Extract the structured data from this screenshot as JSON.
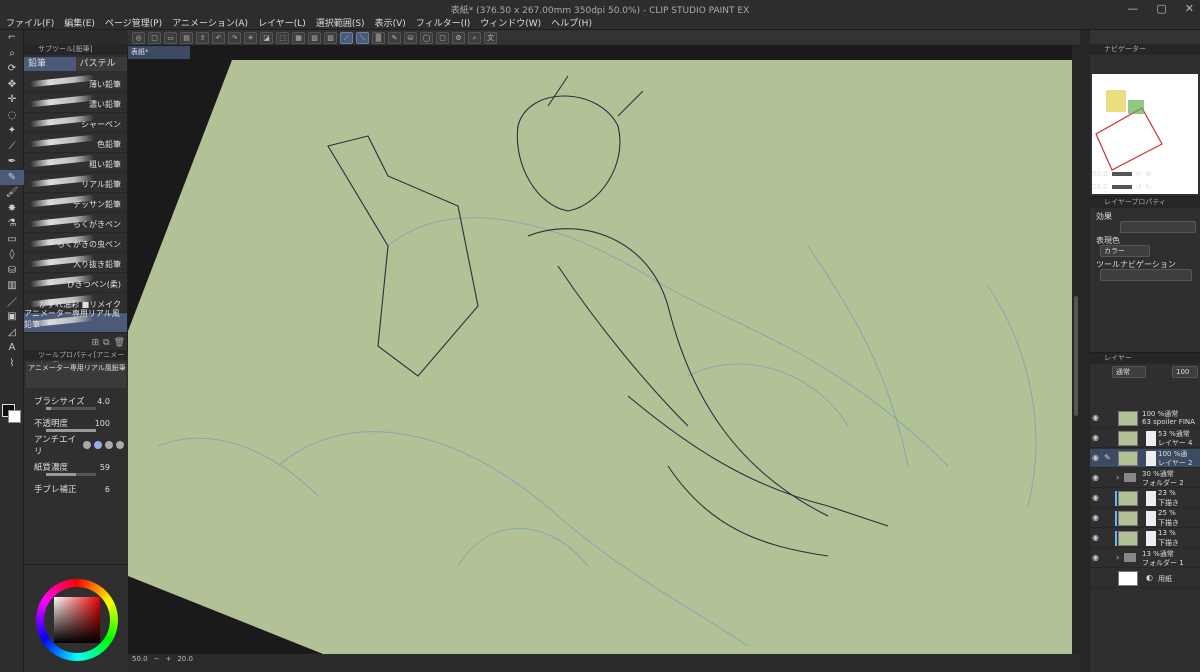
{
  "app": {
    "title": "表紙* (376.50 x 267.00mm 350dpi 50.0%) - CLIP STUDIO PAINT EX"
  },
  "menu": [
    "ファイル(F)",
    "編集(E)",
    "ページ管理(P)",
    "アニメーション(A)",
    "レイヤー(L)",
    "選択範囲(S)",
    "表示(V)",
    "フィルター(I)",
    "ウィンドウ(W)",
    "ヘルプ(H)"
  ],
  "document_tab": "表紙*",
  "subtool": {
    "header": "サブツール[鉛筆]",
    "tabs": [
      "鉛筆",
      "パステル"
    ],
    "brushes": [
      "薄い鉛筆",
      "濃い鉛筆",
      "シャーペン",
      "色鉛筆",
      "粗い鉛筆",
      "リアル鉛筆",
      "デッサン鉛筆",
      "らくがきペン",
      "らくがきの虫ペン",
      "入り抜き鉛筆",
      "ひきつペン(柔)",
      "かすれ油彩 ■リメイク",
      "アニメーター専用リアル風鉛筆"
    ],
    "selected_brush": "アニメーター専用リアル風鉛筆"
  },
  "tool_property": {
    "header": "ツールプロパティ[アニメーター専",
    "preview_label": "アニメーター専用リアル風鉛筆 仕内の人生",
    "brush_size_label": "ブラシサイズ",
    "brush_size_value": "4.0",
    "brush_size_level": 0.1,
    "opacity_label": "不透明度",
    "opacity_value": "100",
    "opacity_level": 1.0,
    "antialias_label": "アンチエイリ",
    "paper_texture_label": "紙質濃度",
    "paper_texture_value": "59",
    "paper_texture_level": 0.59,
    "stabilization_label": "手ブレ補正",
    "stabilization_value": "6"
  },
  "status": {
    "zoom": "50.0",
    "rotation": "20.0"
  },
  "navigator": {
    "header": "ナビゲーター",
    "zoom": "50.0",
    "rotation": "20.0"
  },
  "layer_property": {
    "header": "レイヤープロパティ",
    "effect_label": "効果",
    "display_color_label": "表現色",
    "display_color_value": "カラー",
    "tool_nav_label": "ツールナビゲーション"
  },
  "layers": {
    "header": "レイヤー",
    "blend_mode": "通常",
    "opacity": "100",
    "items": [
      {
        "line1": "100 %通常",
        "line2": "63 spoiler FINA"
      },
      {
        "line1": "53 %通常",
        "line2": "レイヤー 4"
      },
      {
        "line1": "100 %通",
        "line2": "レイヤー 2"
      },
      {
        "line1": "30 %通常",
        "line2": "フォルダー 2"
      },
      {
        "line1": "23 %",
        "line2": "下描き"
      },
      {
        "line1": "25 %",
        "line2": "下描き"
      },
      {
        "line1": "13 %",
        "line2": "下描き"
      },
      {
        "line1": "13 %通常",
        "line2": "フォルダー 1"
      },
      {
        "line1": "",
        "line2": "用紙"
      }
    ]
  },
  "colors": {
    "canvas_paper": "#b2c196",
    "accent": "#4a5a78",
    "clip_indicator": "#69b6ff"
  }
}
